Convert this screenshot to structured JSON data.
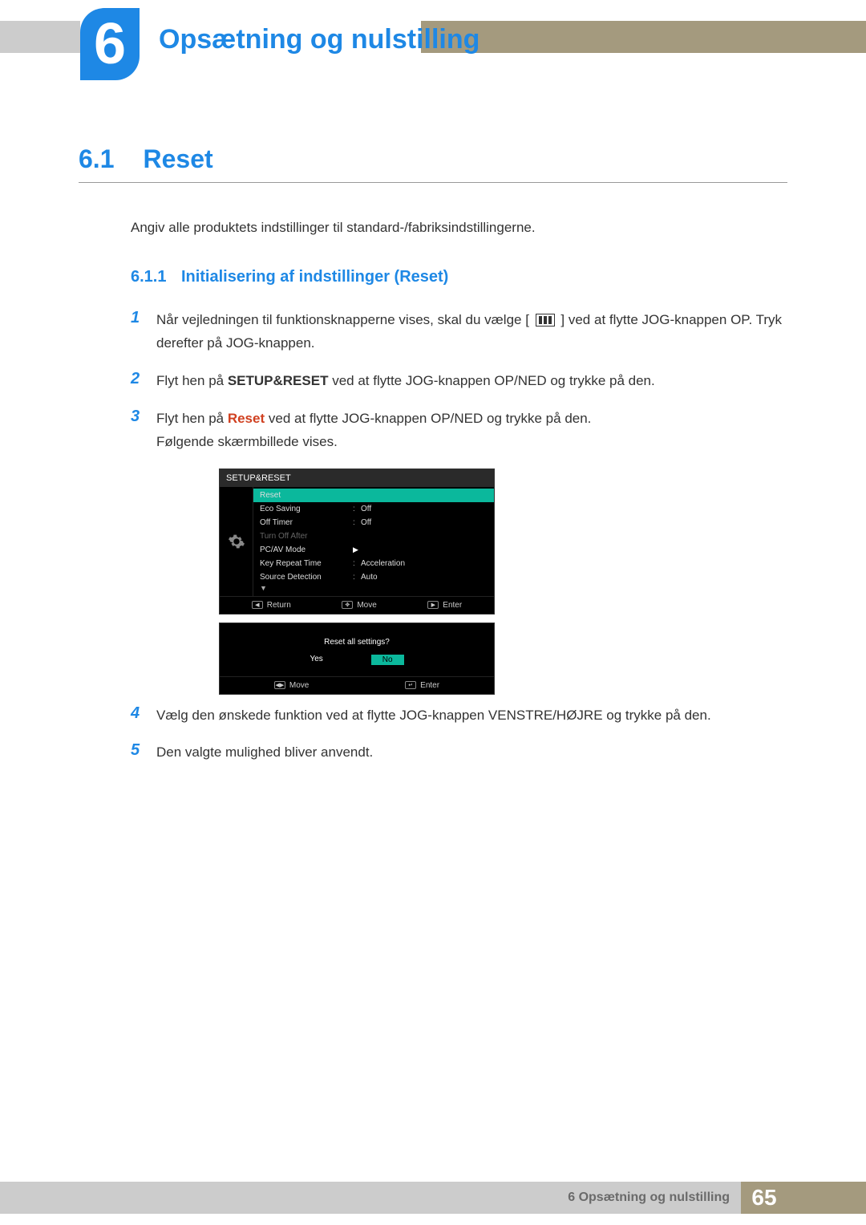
{
  "chapter": {
    "number": "6",
    "title": "Opsætning og nulstilling"
  },
  "section": {
    "number": "6.1",
    "title": "Reset",
    "intro": "Angiv alle produktets indstillinger til standard-/fabriksindstillingerne."
  },
  "subsection": {
    "number": "6.1.1",
    "title": "Initialisering af indstillinger (Reset)"
  },
  "steps": {
    "s1": {
      "num": "1",
      "text_a": "Når vejledningen til funktionsknapperne vises, skal du vælge [",
      "text_b": "] ved at flytte JOG-knappen OP. Tryk derefter på JOG-knappen."
    },
    "s2": {
      "num": "2",
      "text_a": "Flyt hen på ",
      "bold": "SETUP&RESET",
      "text_b": " ved at flytte JOG-knappen OP/NED og trykke på den."
    },
    "s3": {
      "num": "3",
      "text_a": "Flyt hen på ",
      "bold": "Reset",
      "text_b": " ved at flytte JOG-knappen OP/NED og trykke på den.",
      "text_c": "Følgende skærmbillede vises."
    },
    "s4": {
      "num": "4",
      "text": "Vælg den ønskede funktion ved at flytte JOG-knappen VENSTRE/HØJRE og trykke på den."
    },
    "s5": {
      "num": "5",
      "text": "Den valgte mulighed bliver anvendt."
    }
  },
  "osd": {
    "header": "SETUP&RESET",
    "rows": {
      "reset": "Reset",
      "eco": "Eco Saving",
      "eco_val": "Off",
      "off_timer": "Off Timer",
      "off_timer_val": "Off",
      "turn_off": "Turn Off After",
      "pcav": "PC/AV Mode",
      "key_repeat": "Key Repeat Time",
      "key_repeat_val": "Acceleration",
      "source": "Source Detection",
      "source_val": "Auto"
    },
    "footer": {
      "return": "Return",
      "move": "Move",
      "enter": "Enter"
    }
  },
  "dialog": {
    "question": "Reset all settings?",
    "yes": "Yes",
    "no": "No",
    "move": "Move",
    "enter": "Enter"
  },
  "footer": {
    "chapter_label": "6 Opsætning og nulstilling",
    "page": "65"
  }
}
